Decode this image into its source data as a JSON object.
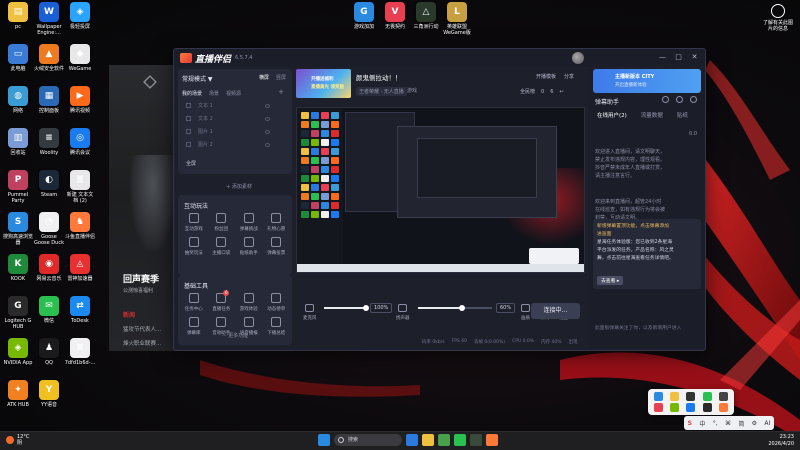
{
  "desktop": {
    "icons": [
      {
        "label": "pc",
        "color": "#f0c040",
        "glyph": "▤"
      },
      {
        "label": "Wallpaper\nEngine:...",
        "color": "#1a5fd6",
        "glyph": "W"
      },
      {
        "label": "极轻投屏",
        "color": "#2aa4ff",
        "glyph": "◈"
      },
      {
        "label": "此电脑",
        "color": "#3a7bd5",
        "glyph": "▭"
      },
      {
        "label": "火绒安全软件",
        "color": "#f07a20",
        "glyph": "▲"
      },
      {
        "label": "WeGame",
        "color": "#e8e8e8",
        "glyph": "◆"
      },
      {
        "label": "网络",
        "color": "#3a9bd5",
        "glyph": "◍"
      },
      {
        "label": "控制面板",
        "color": "#2a6ab5",
        "glyph": "▦"
      },
      {
        "label": "腾讯视频",
        "color": "#ff6a1a",
        "glyph": "▶"
      },
      {
        "label": "回收站",
        "color": "#7a9bd5",
        "glyph": "▥"
      },
      {
        "label": "Woolity",
        "color": "#333a40",
        "glyph": "≡"
      },
      {
        "label": "腾讯会议",
        "color": "#1a7af0",
        "glyph": "◎"
      },
      {
        "label": "Pummel\nParty",
        "color": "#c04060",
        "glyph": "P"
      },
      {
        "label": "Steam",
        "color": "#1b2838",
        "glyph": "◐"
      },
      {
        "label": "新建 文本文\n档 (2)",
        "color": "#e8e8e8",
        "glyph": "≣"
      },
      {
        "label": "搜狗高速浏览\n器",
        "color": "#2a8ae0",
        "glyph": "S"
      },
      {
        "label": "Goose\nGoose Duck",
        "color": "#f0f0f0",
        "glyph": "◔"
      },
      {
        "label": "斗鱼直播伴侣",
        "color": "#ff7a3a",
        "glyph": "♞"
      },
      {
        "label": "KOOK",
        "color": "#1e8a3a",
        "glyph": "K"
      },
      {
        "label": "网易云音乐",
        "color": "#e02a2a",
        "glyph": "◉"
      },
      {
        "label": "雷神加速器",
        "color": "#e83030",
        "glyph": "◬"
      },
      {
        "label": "Logitech G\nHUB",
        "color": "#2a2a2a",
        "glyph": "G"
      },
      {
        "label": "微信",
        "color": "#2ac050",
        "glyph": "✉"
      },
      {
        "label": "ToDesk",
        "color": "#1a8af0",
        "glyph": "⇄"
      },
      {
        "label": "NVIDIA App",
        "color": "#76b900",
        "glyph": "◈"
      },
      {
        "label": "QQ",
        "color": "#1a1a1a",
        "glyph": "♟"
      },
      {
        "label": "7dfd1b6d-...",
        "color": "#f0f0f0",
        "glyph": "≡"
      },
      {
        "label": "ATK HUB",
        "color": "#f08020",
        "glyph": "✦"
      },
      {
        "label": "YY语音",
        "color": "#f0c020",
        "glyph": "Y"
      }
    ],
    "top_icons": [
      {
        "label": "游戏加加",
        "color": "#2a8ae0",
        "glyph": "G"
      },
      {
        "label": "无畏契约",
        "color": "#e84050",
        "glyph": "V"
      },
      {
        "label": "三角洲行动",
        "color": "#2a3a2a",
        "glyph": "△"
      },
      {
        "label": "英雄联盟\nWeGame版",
        "color": "#c8a040",
        "glyph": "L"
      }
    ],
    "notification": "了解有关此图\n片的信息"
  },
  "game_window": {
    "banner": "回声赛季",
    "banner_sub": "公测惊喜福利",
    "news_tab": "新闻",
    "line1": "猛攻节代表人...",
    "line2": "烽火职业联赛..."
  },
  "app": {
    "name": "直播伴侣",
    "version": "6.5.7.4",
    "window_buttons": [
      "—",
      "□",
      "✕"
    ],
    "mode_label": "常规模式 ▼",
    "mode_tabs": [
      "横屏",
      "竖屏"
    ],
    "scene_tabs": [
      "我的场景",
      "场景",
      "视频源"
    ],
    "sources": [
      "文本 1",
      "文本 2",
      "图片 1",
      "图片 2"
    ],
    "sources_all": "全屏",
    "add_source": "+ 添加素材",
    "interactive_title": "互动玩法",
    "interactive_tools": [
      "互动游戏",
      "粉丝团",
      "弹幕挑战",
      "礼物心愿",
      "抽奖玩法",
      "主播口袋",
      "贴纸助手",
      "弹幕投票"
    ],
    "basic_title": "基础工具",
    "basic_tools": [
      "任务中心",
      "直播任务",
      "游戏体验",
      "动态榜单",
      "弹幕库",
      "音效助手",
      "语音播报",
      "下播总结"
    ],
    "basic_badge": "6",
    "more_label": "··· 更多功能",
    "streamer_thumb_l1": "开播送福利",
    "streamer_thumb_l2": "直播高光 领奖励",
    "room_title": "颜鬼侧拉动！！",
    "room_tag": "王者荣耀 · 无人直播",
    "room_sub": "游戏",
    "header_actions": [
      "开播模板",
      "分享"
    ],
    "header_stats": [
      "全民榜",
      "0",
      "6",
      "↩"
    ],
    "controls": [
      {
        "label": "麦克风"
      },
      {
        "label": "扬声器"
      },
      {
        "label": "画质"
      },
      {
        "label": "录制"
      },
      {
        "label": "设置"
      }
    ],
    "mic_pct": "100%",
    "spk_pct": "60%",
    "mic_level": 1.0,
    "spk_level": 0.6,
    "start_button": "连接中...",
    "status": [
      "码率 0kb/s",
      "FPS 60",
      "丢帧 0(0.00%)",
      "CPU 0.0%",
      "内存 40%",
      "出现"
    ]
  },
  "danmaku": {
    "promo_title": "主播新版本 CITY",
    "promo_sub": "开启直播新体验",
    "title": "弹幕助手",
    "tabs": [
      "在线用户(2)",
      "流量数据",
      "贴纸"
    ],
    "count": "0.0",
    "lines": [
      "欢迎进入直播间，请文明聊天，",
      "禁止发布违规内容，理性观看。",
      "抖音严禁未成年人直播或打赏，",
      "请主播注意言行。"
    ],
    "lines2": [
      "欢迎来到直播间，超管24小时",
      "在线巡查，如有违规行为将会被",
      "封禁，互动请文明。"
    ],
    "box_title": "新增弹幕置顶功能，点击弹幕添加",
    "box_title2": "进画面",
    "box_body1": "星海任务体验版：您已收到2条星海",
    "box_body2": "平台派发的任务，产品名称：风之灵",
    "box_body3": "舞，点击前往星海查看任务详情吧。",
    "box_btn": "去查看 ▸",
    "footer": "此面板弹幕关注了你，以及新增用户进入"
  },
  "langbar": {
    "items": [
      "S",
      "中",
      "°,",
      "⌘",
      "简",
      "⚙",
      "AI"
    ]
  },
  "taskbar": {
    "weather_temp": "12°C",
    "weather_text": "阴",
    "search_placeholder": "搜索",
    "time": "23:23",
    "date": "2026/4/20",
    "apps": [
      {
        "color": "#2a7ae0"
      },
      {
        "color": "#f0c040"
      },
      {
        "color": "#4aa04a"
      },
      {
        "color": "#2ac050"
      },
      {
        "color": "#3a4a3a"
      },
      {
        "color": "#ff7a3a"
      }
    ]
  }
}
